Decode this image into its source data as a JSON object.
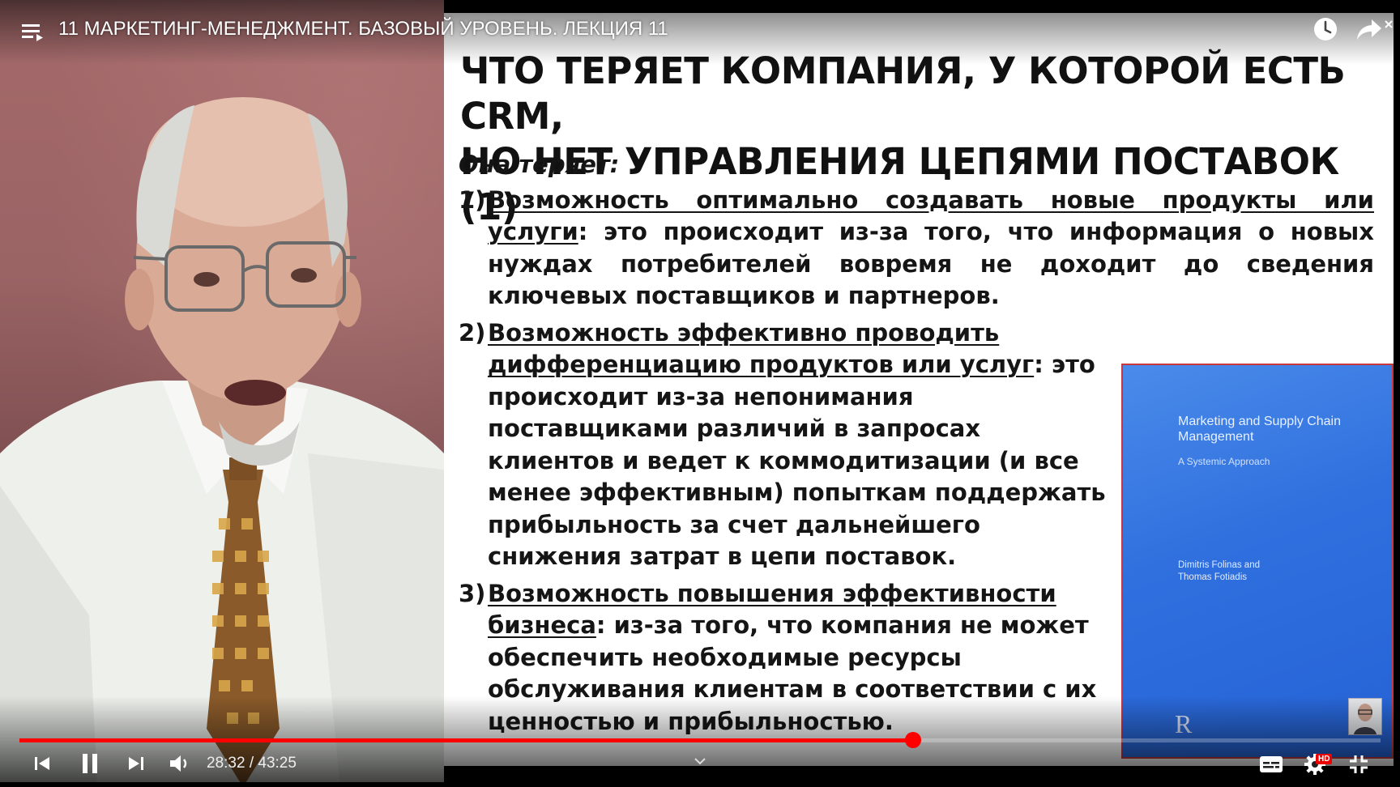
{
  "player": {
    "video_title": "11 МАРКЕТИНГ-МЕНЕДЖМЕНТ. БАЗОВЫЙ УРОВЕНЬ. ЛЕКЦИЯ 11",
    "time_display": "28:32 / 43:25",
    "progress_fraction": 0.6566,
    "buffered_fraction": 0.6437,
    "hd_badge": "HD",
    "accent_color": "#ff0000"
  },
  "slide": {
    "title_line1": "ЧТО ТЕРЯЕТ КОМПАНИЯ, У КОТОРОЙ ЕСТЬ CRM,",
    "title_line2": "НО НЕТ УПРАВЛЕНИЯ ЦЕПЯМИ ПОСТАВОК (1)",
    "lead": "Она теряет:",
    "items": [
      {
        "num": "1)",
        "heading": "Возможность оптимально создавать новые продукты или услуги",
        "text": ": это происходит из-за того, что информация о новых нуждах потребителей вовремя не доходит до сведения ключевых поставщиков и партнеров."
      },
      {
        "num": "2)",
        "heading": "Возможность эффективно проводить дифференциацию продуктов или услуг",
        "text": ": это происходит из-за непонимания поставщиками различий в запросах клиентов и ведет к коммодитизации (и все менее эффективным) попыткам поддержать прибыльность за счет дальнейшего снижения затрат в цепи поставок."
      },
      {
        "num": "3)",
        "heading": "Возможность повышения эффективности бизнеса",
        "text": ": из-за того, что компания не может обеспечить необходимые ресурсы обслуживания клиентам в соответствии с их ценностью и прибыльностью."
      }
    ],
    "book": {
      "title": "Marketing and Supply Chain Management",
      "subtitle": "A Systemic Approach",
      "author1": "Dimitris Folinas",
      "author_joiner": "and",
      "author2": "Thomas Fotiadis",
      "publisher_logo": "R",
      "cover_color": "#2f6fde"
    }
  },
  "icons": {
    "playlist": "playlist-icon",
    "watch_later": "clock-icon",
    "share": "share-icon",
    "close": "close-icon",
    "prev": "previous-icon",
    "pause": "pause-icon",
    "next": "next-icon",
    "volume": "volume-icon",
    "chevron": "chevron-down-icon",
    "subtitles": "subtitles-icon",
    "settings": "gear-icon",
    "exit_fullscreen": "exit-fullscreen-icon"
  }
}
